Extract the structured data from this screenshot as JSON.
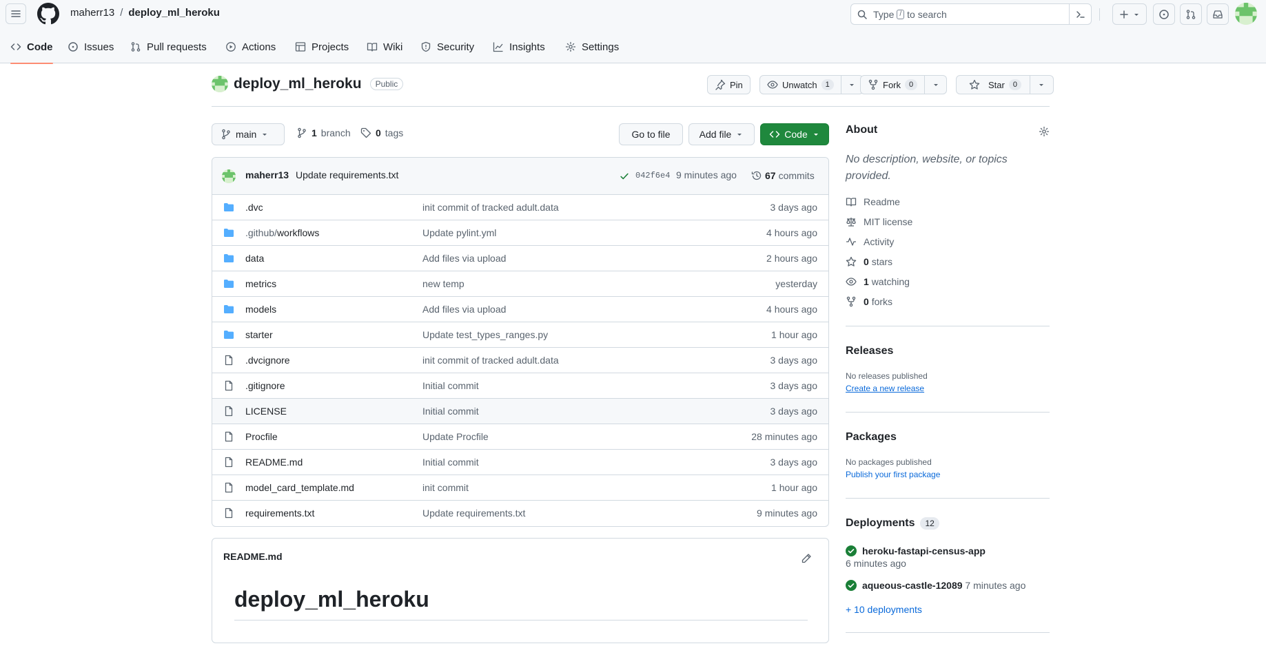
{
  "header": {
    "owner": "maherr13",
    "separator": "/",
    "repo": "deploy_ml_heroku",
    "search_prefix": "Type",
    "search_key": "/",
    "search_suffix": "to search"
  },
  "tabs": [
    {
      "label": "Code",
      "icon": "code-icon"
    },
    {
      "label": "Issues",
      "icon": "issue-icon"
    },
    {
      "label": "Pull requests",
      "icon": "pull-request-icon"
    },
    {
      "label": "Actions",
      "icon": "play-icon"
    },
    {
      "label": "Projects",
      "icon": "table-icon"
    },
    {
      "label": "Wiki",
      "icon": "book-icon"
    },
    {
      "label": "Security",
      "icon": "shield-icon"
    },
    {
      "label": "Insights",
      "icon": "graph-icon"
    },
    {
      "label": "Settings",
      "icon": "gear-icon"
    }
  ],
  "repo": {
    "name": "deploy_ml_heroku",
    "visibility": "Public",
    "pin_label": "Pin",
    "watch_label": "Unwatch",
    "watch_count": "1",
    "fork_label": "Fork",
    "fork_count": "0",
    "star_label": "Star",
    "star_count": "0"
  },
  "toolbar": {
    "branch": "main",
    "branch_count": "1",
    "branch_label": "branch",
    "tag_count": "0",
    "tag_label": "tags",
    "go_to_file": "Go to file",
    "add_file": "Add file",
    "code": "Code"
  },
  "latest_commit": {
    "author": "maherr13",
    "message": "Update requirements.txt",
    "sha": "042f6e4",
    "ago": "9 minutes ago",
    "commit_count": "67",
    "commit_label": "commits"
  },
  "files": [
    {
      "type": "folder",
      "name": ".dvc",
      "prefix": "",
      "message": "init commit of tracked adult.data",
      "age": "3 days ago"
    },
    {
      "type": "folder",
      "name": "workflows",
      "prefix": ".github/",
      "message": "Update pylint.yml",
      "age": "4 hours ago"
    },
    {
      "type": "folder",
      "name": "data",
      "prefix": "",
      "message": "Add files via upload",
      "age": "2 hours ago"
    },
    {
      "type": "folder",
      "name": "metrics",
      "prefix": "",
      "message": "new temp",
      "age": "yesterday"
    },
    {
      "type": "folder",
      "name": "models",
      "prefix": "",
      "message": "Add files via upload",
      "age": "4 hours ago"
    },
    {
      "type": "folder",
      "name": "starter",
      "prefix": "",
      "message": "Update test_types_ranges.py",
      "age": "1 hour ago"
    },
    {
      "type": "file",
      "name": ".dvcignore",
      "prefix": "",
      "message": "init commit of tracked adult.data",
      "age": "3 days ago"
    },
    {
      "type": "file",
      "name": ".gitignore",
      "prefix": "",
      "message": "Initial commit",
      "age": "3 days ago"
    },
    {
      "type": "file",
      "name": "LICENSE",
      "prefix": "",
      "message": "Initial commit",
      "age": "3 days ago"
    },
    {
      "type": "file",
      "name": "Procfile",
      "prefix": "",
      "message": "Update Procfile",
      "age": "28 minutes ago"
    },
    {
      "type": "file",
      "name": "README.md",
      "prefix": "",
      "message": "Initial commit",
      "age": "3 days ago"
    },
    {
      "type": "file",
      "name": "model_card_template.md",
      "prefix": "",
      "message": "init commit",
      "age": "1 hour ago"
    },
    {
      "type": "file",
      "name": "requirements.txt",
      "prefix": "",
      "message": "Update requirements.txt",
      "age": "9 minutes ago"
    }
  ],
  "readme": {
    "file_label": "README.md",
    "heading": "deploy_ml_heroku"
  },
  "about": {
    "title": "About",
    "description": "No description, website, or topics provided.",
    "readme": "Readme",
    "license": "MIT license",
    "activity": "Activity",
    "stars_count": "0",
    "stars_label": "stars",
    "watching_count": "1",
    "watching_label": "watching",
    "forks_count": "0",
    "forks_label": "forks"
  },
  "releases": {
    "title": "Releases",
    "empty": "No releases published",
    "create_link": "Create a new release"
  },
  "packages": {
    "title": "Packages",
    "empty": "No packages published",
    "publish_link": "Publish your first package"
  },
  "deployments": {
    "title": "Deployments",
    "count": "12",
    "items": [
      {
        "name": "heroku-fastapi-census-app",
        "ago": "6 minutes ago"
      },
      {
        "name": "aqueous-castle-12089",
        "ago": "7 minutes ago"
      }
    ],
    "more_link": "+ 10 deployments"
  },
  "colors": {
    "accent_tab": "#fd8c73",
    "primary_button": "#1f883d",
    "link": "#0969da",
    "folder": "#54aeff",
    "success": "#1a7f37"
  }
}
